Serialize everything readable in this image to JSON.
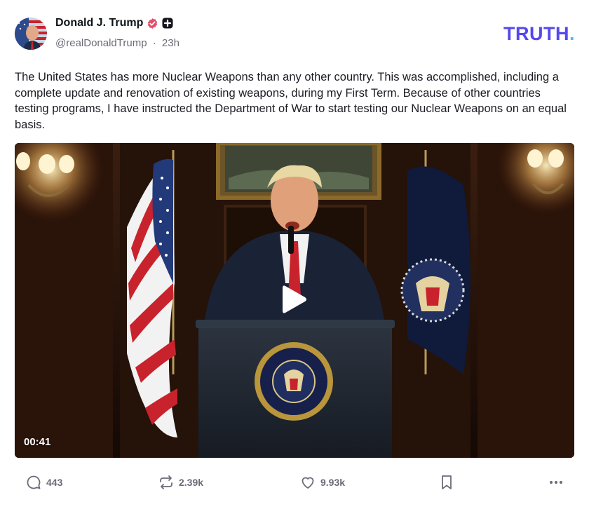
{
  "author": {
    "display_name": "Donald J. Trump",
    "handle": "@realDonaldTrump",
    "separator": "·",
    "time_ago": "23h"
  },
  "brand": {
    "logo_text": "TRUTH",
    "logo_dot": ".",
    "accent_color": "#5448ee",
    "dot_color": "#46c3f0"
  },
  "post": {
    "text": "The United States has more Nuclear Weapons than any other country. This was accomplished, including a complete update and renovation of existing weapons, during my First Term. Because of other countries testing programs, I have instructed the Department of War to start testing our Nuclear Weapons on an equal basis."
  },
  "media": {
    "type": "video",
    "duration": "00:41",
    "play_icon": "play-icon"
  },
  "actions": {
    "replies": "443",
    "retruths": "2.39k",
    "likes": "9.93k"
  },
  "icons": {
    "reply": "comment-bubble-icon",
    "retruth": "repost-arrows-icon",
    "like": "heart-icon",
    "bookmark": "bookmark-icon",
    "more": "more-dots-icon",
    "verified": "verified-badge-icon",
    "plus": "plus-badge-icon"
  }
}
